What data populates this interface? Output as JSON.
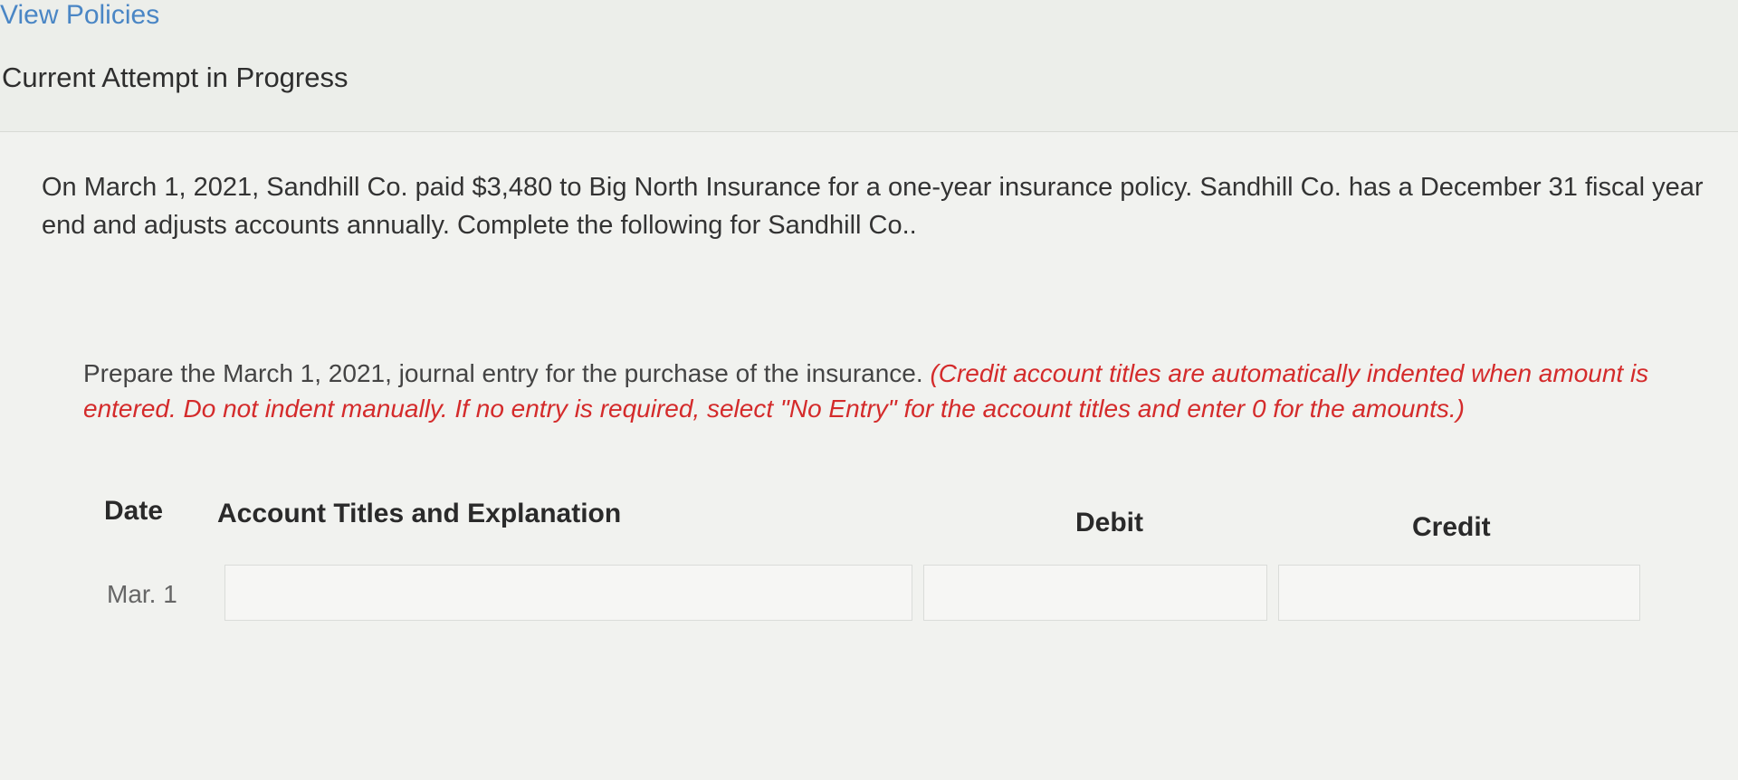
{
  "header": {
    "view_policies": "View Policies",
    "attempt_status": "Current Attempt in Progress"
  },
  "problem": {
    "text": "On March 1, 2021, Sandhill Co. paid $3,480 to Big North Insurance for a one-year insurance policy. Sandhill Co. has a December 31 fiscal year end and adjusts accounts annually. Complete the following for Sandhill Co.."
  },
  "instruction": {
    "main": "Prepare the March 1, 2021, journal entry for the purchase of the insurance. ",
    "note": "(Credit account titles are automatically indented when amount is entered. Do not indent manually. If no entry is required, select \"No Entry\" for the account titles and enter 0 for the amounts.)"
  },
  "journal": {
    "columns": {
      "date": "Date",
      "account": "Account Titles and Explanation",
      "debit": "Debit",
      "credit": "Credit"
    },
    "rows": [
      {
        "date": "Mar. 1",
        "account": "",
        "debit": "",
        "credit": ""
      }
    ]
  }
}
